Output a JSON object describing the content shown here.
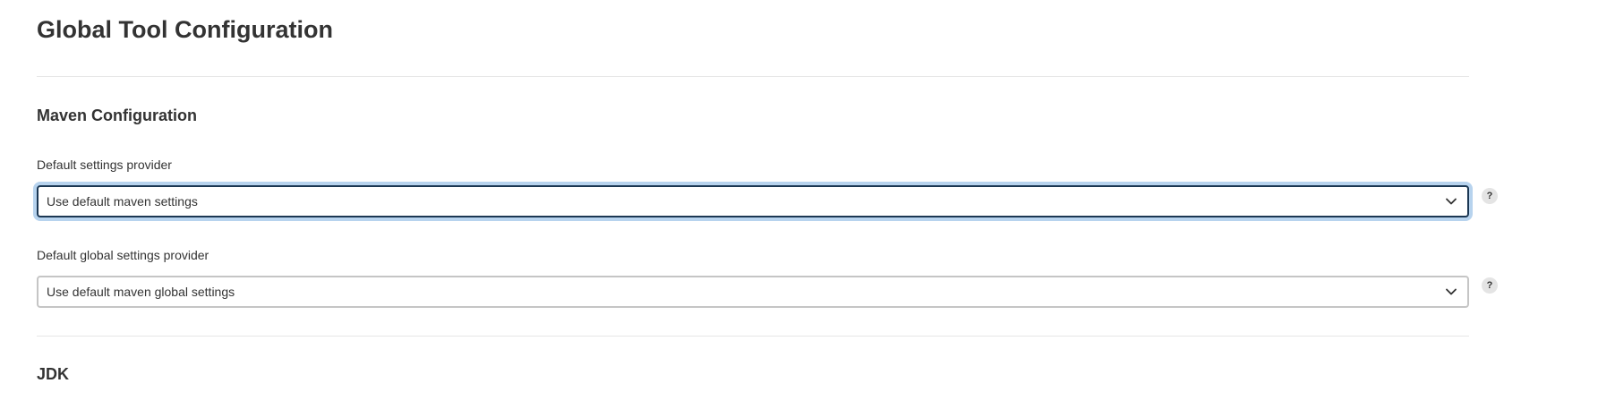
{
  "page": {
    "title": "Global Tool Configuration"
  },
  "maven": {
    "section_title": "Maven Configuration",
    "settings_provider": {
      "label": "Default settings provider",
      "selected": "Use default maven settings",
      "help": "?"
    },
    "global_settings_provider": {
      "label": "Default global settings provider",
      "selected": "Use default maven global settings",
      "help": "?"
    }
  },
  "jdk": {
    "section_title": "JDK"
  },
  "icons": {
    "dropdown": "chevron-down-icon",
    "help": "help-icon"
  },
  "colors": {
    "focus_border": "#1b3753",
    "focus_ring": "#b7d3ee",
    "text": "#333333"
  }
}
